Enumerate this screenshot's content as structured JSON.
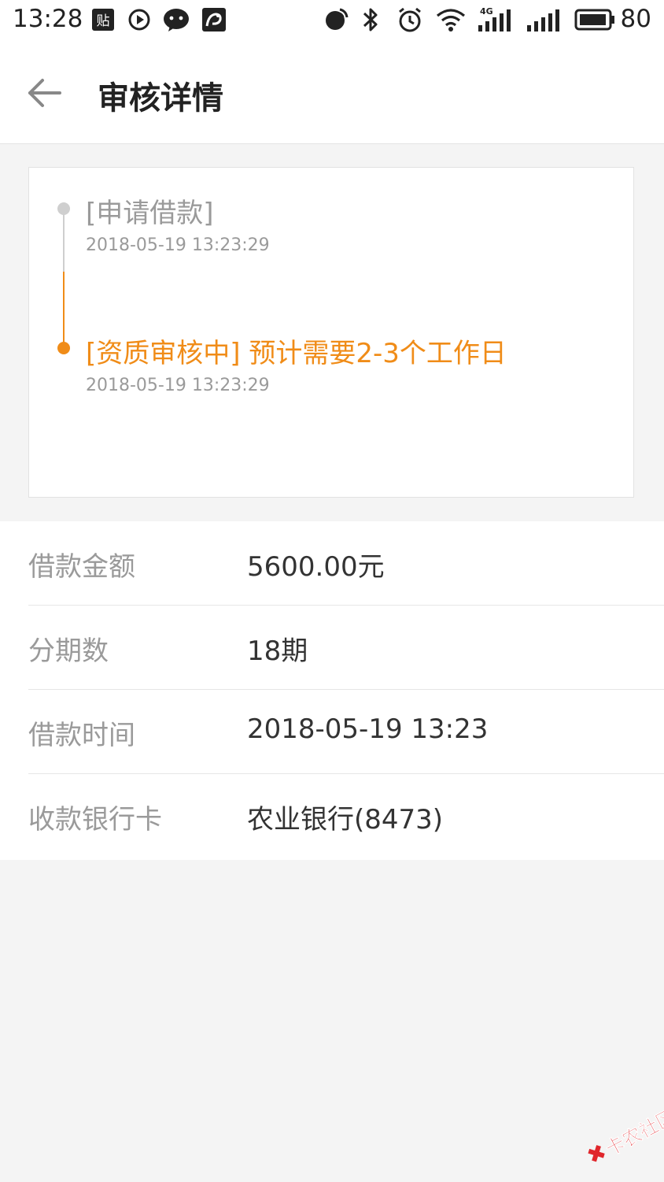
{
  "status_bar": {
    "time": "13:28",
    "app_icons": [
      "tieba-icon",
      "play-icon",
      "wechat-icon",
      "uc-browser-icon"
    ],
    "network_label": "4G",
    "battery_level": "80"
  },
  "header": {
    "title": "审核详情"
  },
  "timeline": [
    {
      "title": "[申请借款]",
      "time": "2018-05-19 13:23:29",
      "state": "done"
    },
    {
      "title": "[资质审核中] 预计需要2-3个工作日",
      "time": "2018-05-19 13:23:29",
      "state": "active"
    }
  ],
  "details": [
    {
      "label": "借款金额",
      "value": "5600.00元"
    },
    {
      "label": "分期数",
      "value": "18期"
    },
    {
      "label": "借款时间",
      "value": "2018-05-19 13:23"
    },
    {
      "label": "收款银行卡",
      "value": "农业银行(8473)"
    }
  ],
  "watermark": {
    "text": "卡农社区"
  },
  "colors": {
    "accent": "#f08c18",
    "muted": "#9a9a9a",
    "text": "#333333",
    "background": "#f4f4f4"
  }
}
